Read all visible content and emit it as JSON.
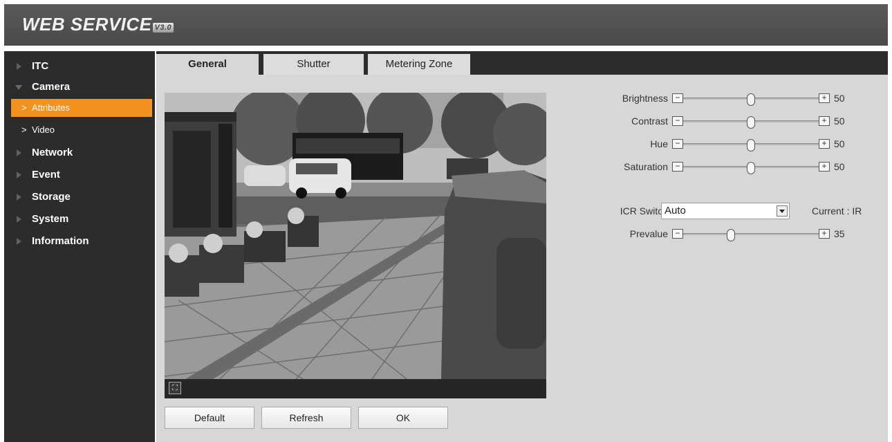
{
  "header": {
    "logo": "WEB SERVICE",
    "version": "V3.0"
  },
  "sidebar": {
    "items": [
      {
        "label": "ITC"
      },
      {
        "label": "Camera"
      },
      {
        "label": "Attributes"
      },
      {
        "label": "Video"
      },
      {
        "label": "Network"
      },
      {
        "label": "Event"
      },
      {
        "label": "Storage"
      },
      {
        "label": "System"
      },
      {
        "label": "Information"
      }
    ]
  },
  "tabs": [
    {
      "label": "General"
    },
    {
      "label": "Shutter"
    },
    {
      "label": "Metering Zone"
    }
  ],
  "buttons": {
    "default": "Default",
    "refresh": "Refresh",
    "ok": "OK"
  },
  "sliders": [
    {
      "label": "Brightness",
      "value": "50",
      "level": 50
    },
    {
      "label": "Contrast",
      "value": "50",
      "level": 50
    },
    {
      "label": "Hue",
      "value": "50",
      "level": 50
    },
    {
      "label": "Saturation",
      "value": "50",
      "level": 50
    }
  ],
  "icr": {
    "label": "ICR Switch",
    "selected": "Auto",
    "current": "Current : IR"
  },
  "prevalue": {
    "label": "Prevalue",
    "value": "35",
    "level": 35
  },
  "colors": {
    "accent": "#f39121",
    "sidebar": "#2c2c2c",
    "panel": "#d7d7d7"
  }
}
